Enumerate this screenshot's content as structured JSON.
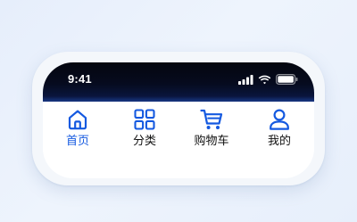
{
  "status_bar": {
    "time": "9:41",
    "signal_icon": "cellular-signal-icon",
    "wifi_icon": "wifi-icon",
    "battery_icon": "battery-icon"
  },
  "tab_bar": {
    "active_index": 0,
    "active_color": "#1459E0",
    "inactive_color": "#111111",
    "tabs": [
      {
        "label": "首页",
        "icon": "home-icon"
      },
      {
        "label": "分类",
        "icon": "grid-icon"
      },
      {
        "label": "购物车",
        "icon": "shopping-cart-icon"
      },
      {
        "label": "我的",
        "icon": "user-icon"
      }
    ]
  }
}
